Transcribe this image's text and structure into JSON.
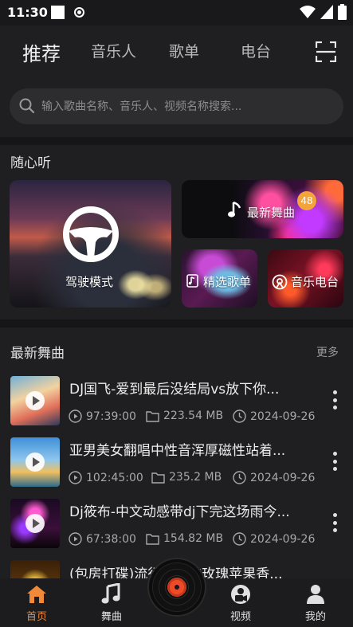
{
  "status_bar": {
    "time": "11:30"
  },
  "top_tabs": [
    {
      "label": "推荐",
      "active": true
    },
    {
      "label": "音乐人",
      "active": false
    },
    {
      "label": "歌单",
      "active": false
    },
    {
      "label": "电台",
      "active": false
    }
  ],
  "search": {
    "placeholder": "输入歌曲名称、音乐人、视频名称搜索..."
  },
  "section1": {
    "title": "随心听"
  },
  "cards": {
    "drive": "驾驶模式",
    "new_dance": "最新舞曲",
    "new_dance_badge": "48",
    "playlist": "精选歌单",
    "radio": "音乐电台"
  },
  "section2": {
    "title": "最新舞曲",
    "more": "更多"
  },
  "songs": [
    {
      "title": "DJ国飞-爱到最后没结局vs放下你...",
      "duration": "97:39:00",
      "size": "223.54 MB",
      "date": "2024-09-26"
    },
    {
      "title": "亚男美女翻唱中性音浑厚磁性站着...",
      "duration": "102:45:00",
      "size": "235.2 MB",
      "date": "2024-09-26"
    },
    {
      "title": "Dj筱布-中文动感带dj下完这场雨今...",
      "duration": "67:38:00",
      "size": "154.82 MB",
      "date": "2024-09-26"
    },
    {
      "title": "(包房打碟)流行中文的玫瑰苹果香..."
    }
  ],
  "bottom_nav": [
    {
      "label": "首页",
      "active": true
    },
    {
      "label": "舞曲",
      "active": false
    },
    {
      "label": "视频",
      "active": false
    },
    {
      "label": "我的",
      "active": false
    }
  ],
  "colors": {
    "accent": "#f08a3a",
    "background": "#1f1f21",
    "badge": "#f3a43b"
  }
}
